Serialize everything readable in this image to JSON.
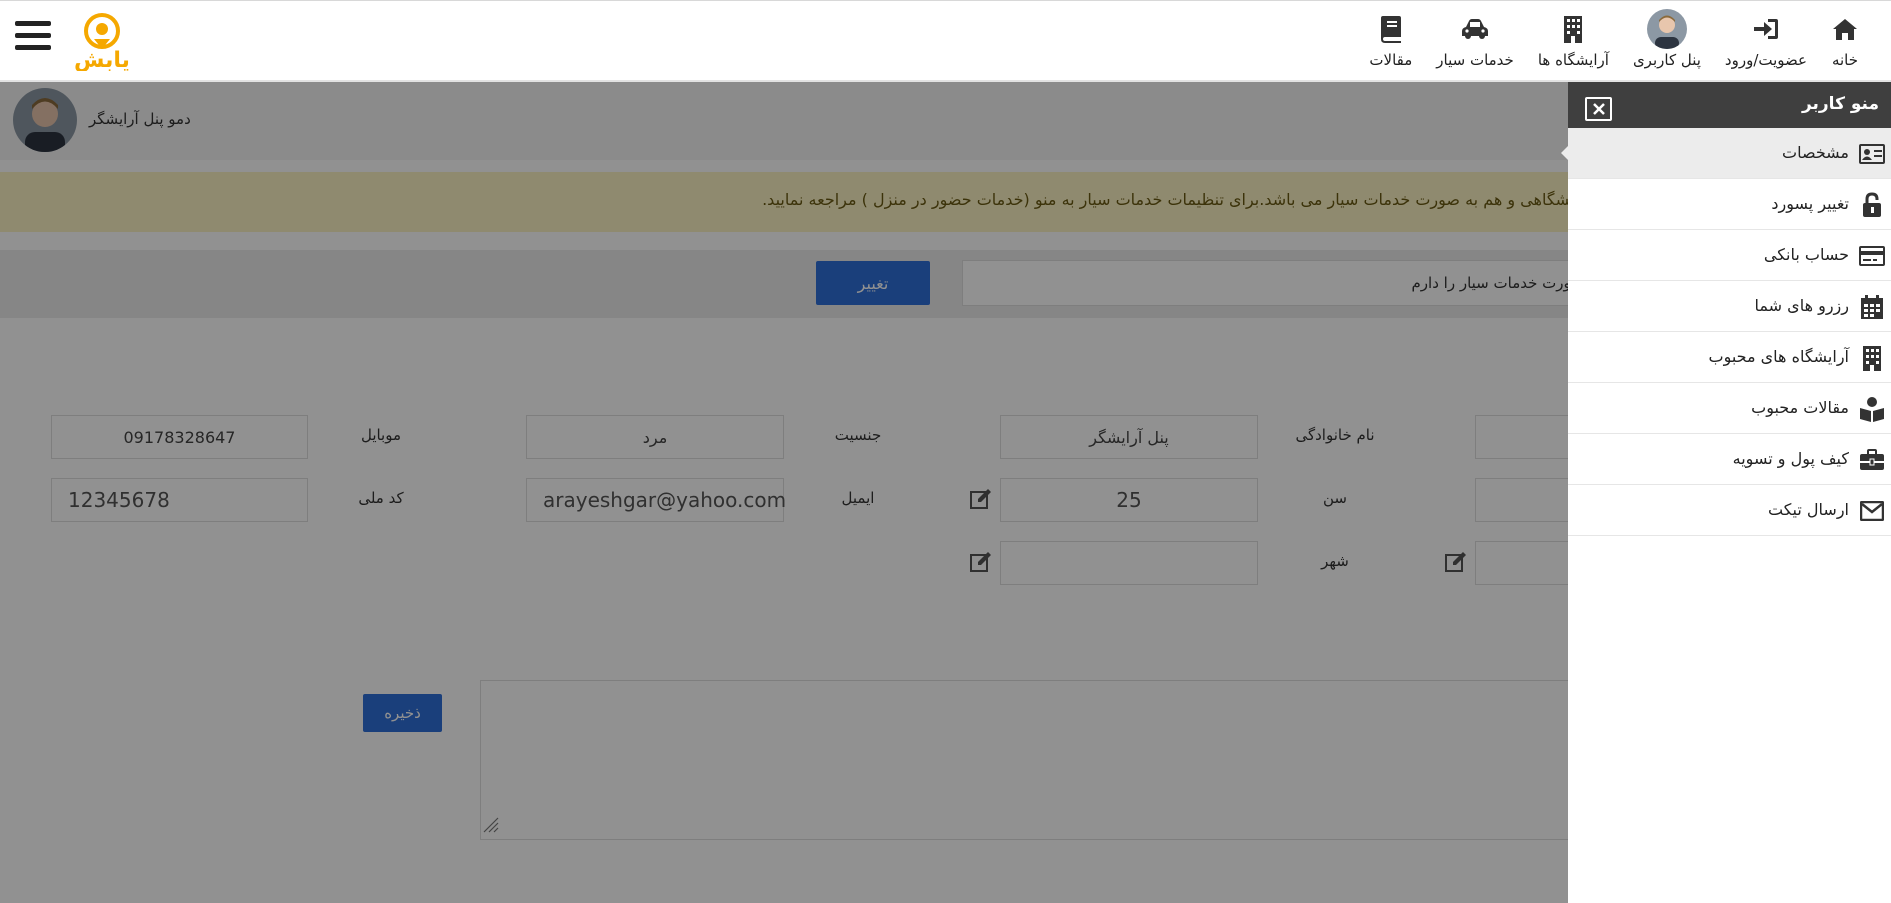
{
  "header": {
    "logo_text": "یابش",
    "nav": [
      {
        "label": "خانه",
        "icon": "home-icon"
      },
      {
        "label": "عضویت/ورود",
        "icon": "sign-in-icon"
      },
      {
        "label": "پنل کاربری",
        "icon": "user-avatar"
      },
      {
        "label": "آرایشگاه ها",
        "icon": "building-icon"
      },
      {
        "label": "خدمات سیار",
        "icon": "car-icon"
      },
      {
        "label": "مقالات",
        "icon": "book-icon"
      }
    ]
  },
  "profile": {
    "name": "دمو پنل آرایشگر"
  },
  "alert": {
    "text": "آرایشگاهی و هم به صورت خدمات سیار می باشد.برای تنظیمات خدمات سیار به منو (خدمات حضور در منزل ) مراجعه نمایید."
  },
  "service_mode": {
    "value": "به صورت خدمات سیار را دارم",
    "button": "تغییر"
  },
  "form": {
    "family_label": "نام خانوادگی",
    "family_value": "پنل آرایشگر",
    "gender_label": "جنسیت",
    "gender_value": "مرد",
    "mobile_label": "موبایل",
    "mobile_value": "09178328647",
    "age_label": "سن",
    "age_value": "25",
    "email_label": "ایمیل",
    "email_value": "arayeshgar@yahoo.com",
    "national_label": "کد ملی",
    "national_value": "12345678",
    "city_label": "شهر",
    "city_value": "",
    "save_button": "ذخیره"
  },
  "sidebar": {
    "title": "منو کاربر",
    "items": [
      {
        "label": "مشخصات",
        "icon": "id-card-icon",
        "active": true
      },
      {
        "label": "تغییر پسورد",
        "icon": "unlock-icon"
      },
      {
        "label": "حساب بانکی",
        "icon": "credit-card-icon"
      },
      {
        "label": "رزرو های شما",
        "icon": "calendar-icon"
      },
      {
        "label": "آرایشگاه های محبوب",
        "icon": "building-icon"
      },
      {
        "label": "مقالات محبوب",
        "icon": "book-reader-icon"
      },
      {
        "label": "کیف پول و تسویه",
        "icon": "briefcase-icon"
      },
      {
        "label": "ارسال تیکت",
        "icon": "envelope-icon"
      }
    ]
  },
  "colors": {
    "primary": "#2f6fd8",
    "accent": "#f5a800",
    "alert_bg": "#fcf3c4",
    "sidebar_head": "#3f3f3f"
  }
}
